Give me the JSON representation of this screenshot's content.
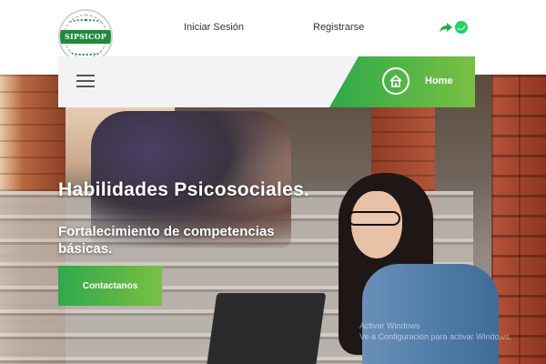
{
  "header": {
    "logo_text": "SIPSICOP",
    "nav": {
      "login": "Iniciar Sesión",
      "register": "Registrarse"
    },
    "icons": [
      "share-icon",
      "whatsapp-icon"
    ]
  },
  "menubar": {
    "home_label": "Home",
    "icons": [
      "hamburger-icon",
      "home-icon"
    ]
  },
  "hero": {
    "title": "Habilidades Psicosociales.",
    "subtitle": "Fortalecimiento de competencias básicas.",
    "cta_label": "Contactanos"
  },
  "watermark": {
    "line1": "Activar Windows",
    "line2": "Ve a Configuración para activar Windows."
  },
  "colors": {
    "accent_start": "#2ea84a",
    "accent_end": "#79c043",
    "whatsapp": "#25d366"
  }
}
